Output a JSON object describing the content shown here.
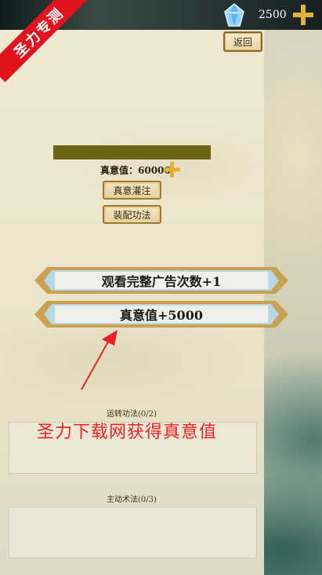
{
  "header": {
    "currency_value": "2500",
    "back_label": "返回"
  },
  "watermark": {
    "corner_tag": "圣力专测",
    "red_text": "圣力下载网获得真意值"
  },
  "stats": {
    "zhenyi_label": "真意值：60006"
  },
  "buttons": {
    "inject": "真意灌注",
    "equip": "装配功法",
    "watch_ad": "观看完整广告次数+1",
    "zhenyi_plus": "真意值+5000"
  },
  "sections": {
    "yunzhuan": "运转功法(0/2)",
    "zhudong": "主动术法(0/3)"
  },
  "icons": {
    "gem": "crystal-gem-icon",
    "plus": "plus-icon",
    "arrow": "red-arrow-icon"
  },
  "colors": {
    "accent_gold": "#e0b23a",
    "red": "#e1141e",
    "progress_bar": "#6b6416"
  }
}
